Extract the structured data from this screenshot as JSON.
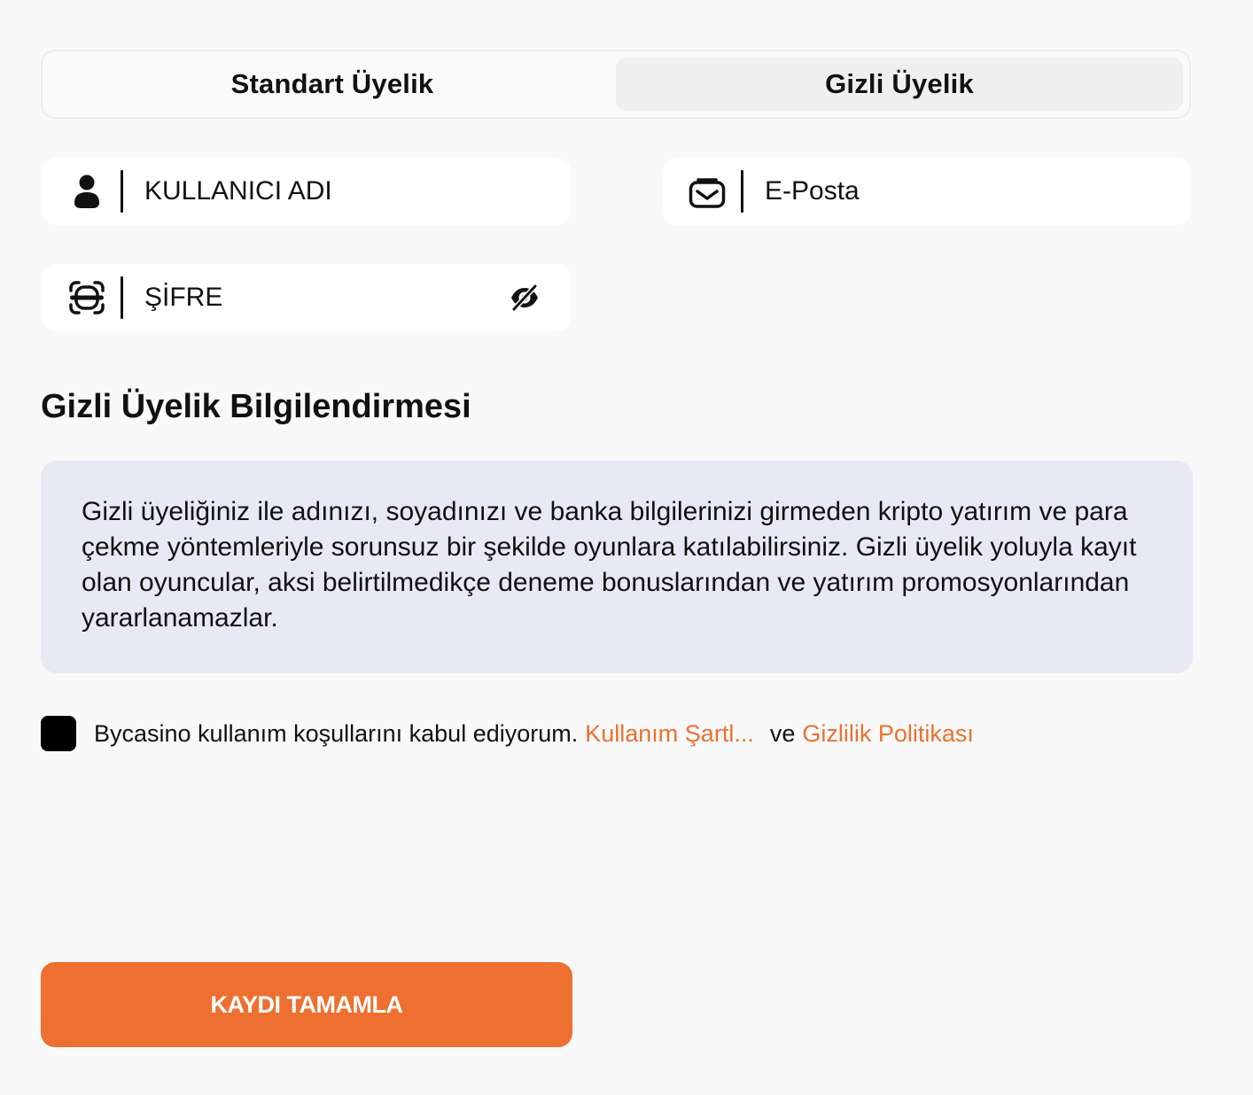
{
  "tabs": {
    "standard_label": "Standart Üyelik",
    "hidden_label": "Gizli Üyelik",
    "active": "hidden"
  },
  "form": {
    "username": {
      "placeholder": "KULLANICI ADI",
      "value": "",
      "icon": "user-icon"
    },
    "email": {
      "placeholder": "E-Posta",
      "value": "",
      "icon": "mail-icon"
    },
    "password": {
      "placeholder": "ŞİFRE",
      "value": "",
      "icon": "password-icon",
      "toggle_icon": "eye-slash-icon"
    }
  },
  "info": {
    "title": "Gizli Üyelik Bilgilendirmesi",
    "text": "Gizli üyeliğiniz ile adınızı, soyadınızı ve banka bilgilerinizi girmeden kripto yatırım ve para çekme yöntemleriyle sorunsuz bir şekilde oyunlara katılabilirsiniz. Gizli üyelik yoluyla kayıt olan oyuncular, aksi belirtilmedikçe deneme bonuslarından ve yatırım promosyonlarından yararlanamazlar."
  },
  "terms": {
    "checked": false,
    "text": "Bycasino kullanım koşullarını kabul ediyorum.",
    "terms_link": "Kullanım Şartl...",
    "conjunction": "ve",
    "privacy_link": "Gizlilik Politikası"
  },
  "submit_label": "KAYDI TAMAMLA",
  "colors": {
    "accent": "#ed7030",
    "background": "#f9f9f9",
    "info_box": "#e8e9f4",
    "field": "#ffffff"
  }
}
